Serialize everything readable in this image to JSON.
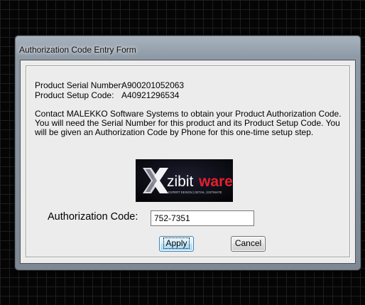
{
  "window": {
    "title": "Authorization Code Entry Form"
  },
  "product": {
    "serial_label": "Product Serial Number:",
    "serial_value": "A900201052063",
    "setup_label": "Product Setup Code:",
    "setup_value": "A40921296534"
  },
  "contact_text": "Contact MALEKKO Software Systems to obtain your Product Authorization Code.  You will need the Serial Number for this product and its Product Setup Code.  You will be given an Authorization Code by Phone for this one-time setup step.",
  "logo": {
    "brand_x": "X",
    "brand_main": "zibit",
    "brand_accent": "ware",
    "tagline": "EXPERT DESIGN | DETAIL | ESTIMATE",
    "colors": {
      "background": "#0a0a14",
      "accent": "#e5202e",
      "text": "#ffffff"
    }
  },
  "authorization": {
    "label": "Authorization Code:",
    "value": "752-7351"
  },
  "buttons": {
    "apply": "Apply",
    "cancel": "Cancel"
  }
}
